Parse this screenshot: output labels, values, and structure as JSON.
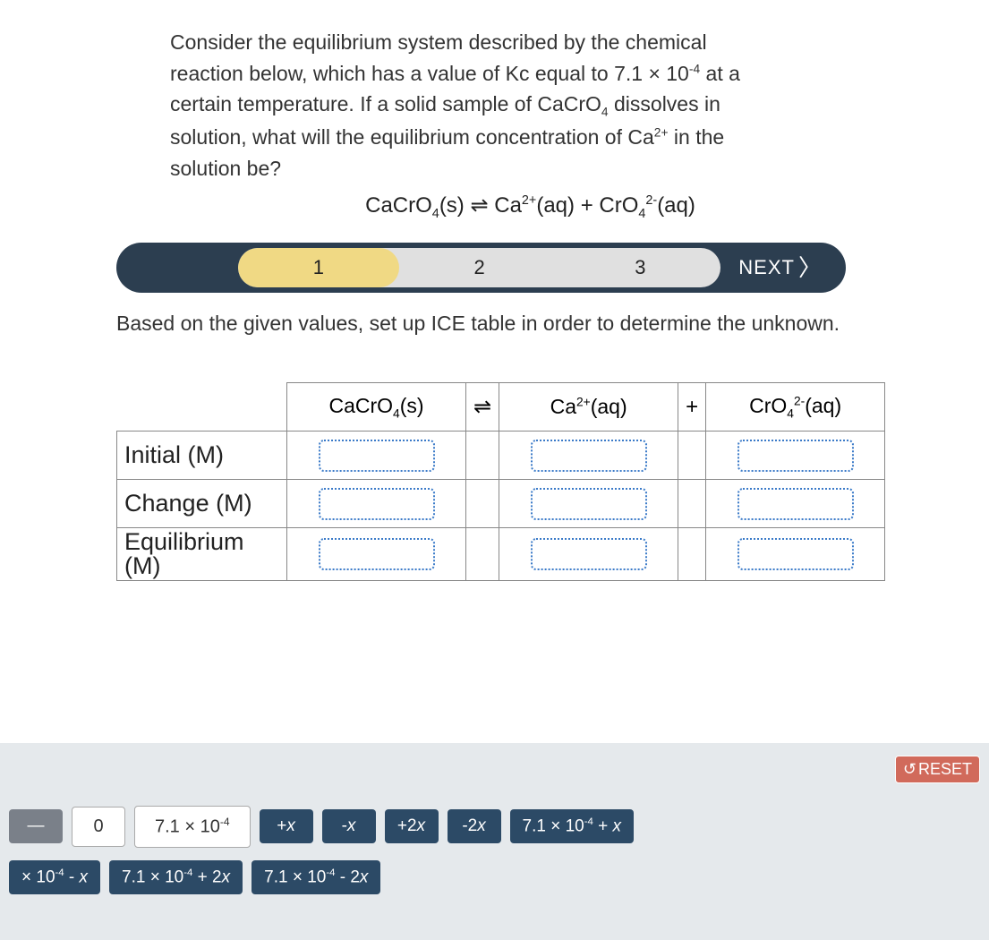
{
  "question_html": "Consider the equilibrium system described by the chemical reaction below, which has a value of Kc equal to 7.1 × 10⁻⁴ at a certain temperature. If a solid sample of CaCrO₄ dissolves in solution, what will the equilibrium concentration of Ca²⁺ in the solution be?",
  "equation": {
    "reactant": "CaCrO₄(s)",
    "arrow": "⇌",
    "product1": "Ca²⁺(aq)",
    "plus": "+",
    "product2": "CrO₄²⁻(aq)"
  },
  "steps": {
    "s1": "1",
    "s2": "2",
    "s3": "3",
    "next": "NEXT"
  },
  "instruction": "Based on the given values, set up ICE table in order to determine the unknown.",
  "ice": {
    "col1": "CaCrO₄(s)",
    "arrow": "⇌",
    "col2": "Ca²⁺(aq)",
    "plus": "+",
    "col3": "CrO₄²⁻(aq)",
    "row_initial": "Initial (M)",
    "row_change": "Change (M)",
    "row_eq": "Equilibrium (M)"
  },
  "reset": "RESET",
  "tiles": {
    "dash": "—",
    "zero": "0",
    "k": "7.1 × 10⁻⁴",
    "px": "+x",
    "mx": "-x",
    "p2x": "+2x",
    "m2x": "-2x",
    "kpx": "7.1 × 10⁻⁴ + x",
    "kmx": "× 10⁻⁴ - x",
    "kp2x": "7.1 × 10⁻⁴ + 2x",
    "km2x": "7.1 × 10⁻⁴ - 2x"
  }
}
